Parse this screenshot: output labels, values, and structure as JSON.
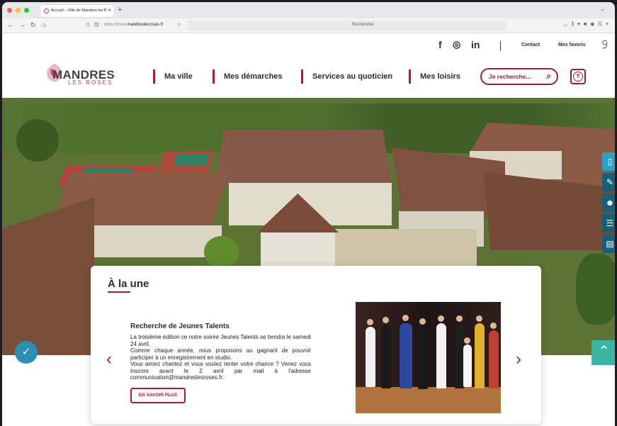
{
  "browser": {
    "tab_title": "Accueil – Ville de Mandres les R",
    "url_prefix": "https://www.",
    "url_domain": "mandreslesroses.fr",
    "search_placeholder": "Rechercher"
  },
  "header": {
    "social": [
      "f",
      "ⓘ",
      "in"
    ],
    "contact_label": "Contact",
    "favorites_label": "Mes favoris",
    "logo_name": "MANDRES",
    "logo_sub": "LES ROSES",
    "menu": [
      "Ma ville",
      "Mes démarches",
      "Services au quoticien",
      "Mes loisirs"
    ],
    "search_label": "Je recherche..."
  },
  "featured": {
    "title": "À la une",
    "article_title": "Recherche de Jeunes Talents",
    "paragraphs": [
      "La troisième édition ce notre soirée Jeunes Talents se tiendra le samedi 24 avril.",
      "Comme chaque année, nous proposons au gagnant de pouvoir participer à un enregistrement en studio.",
      "Vous aimez chantez et vous voulez tenter votre chance ? Venez vous inscrire avant le 2 avril par mail à l'adresse communication@mandreslesroses.fr."
    ],
    "button_label": "EN SAVOIR PLUS",
    "prev_arrow": "‹",
    "next_arrow": "›"
  },
  "colors": {
    "brand": "#b0183e",
    "sidebar": "#1a5f7a",
    "up_button": "#3ab5a4"
  }
}
